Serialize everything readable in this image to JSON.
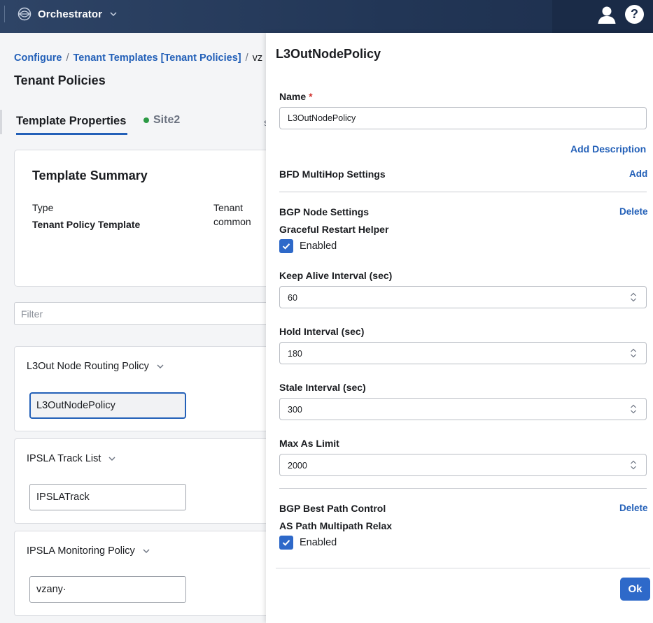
{
  "app": {
    "title": "Orchestrator",
    "logo_icon": "cisco-orchestrator-icon",
    "user_icon": "user-icon",
    "help_label": "?"
  },
  "breadcrumb": {
    "items": [
      "Configure",
      "Tenant Templates [Tenant Policies]",
      "vz"
    ],
    "separator": "/"
  },
  "page": {
    "title": "Tenant Policies",
    "tabs": [
      {
        "label": "Template Properties",
        "active": true
      },
      {
        "label": "Site2",
        "status_color": "#2c9a45"
      }
    ],
    "tab_overflow": "s"
  },
  "summary": {
    "title": "Template Summary",
    "type_label": "Type",
    "type_value": "Tenant Policy Template",
    "tenant_label": "Tenant",
    "tenant_value": "common"
  },
  "filter": {
    "placeholder": "Filter"
  },
  "groups": [
    {
      "title": "L3Out Node Routing Policy",
      "item": "L3OutNodePolicy",
      "selected": true
    },
    {
      "title": "IPSLA Track List",
      "item": "IPSLATrack",
      "selected": false
    },
    {
      "title": "IPSLA Monitoring Policy",
      "item": "vzany·",
      "selected": false
    }
  ],
  "panel": {
    "title": "L3OutNodePolicy",
    "name_label": "Name",
    "required_mark": "*",
    "name_value": "L3OutNodePolicy",
    "add_description": "Add Description",
    "bfd": {
      "title": "BFD MultiHop Settings",
      "action": "Add"
    },
    "bgp_node": {
      "title": "BGP Node Settings",
      "action": "Delete",
      "graceful_label": "Graceful Restart Helper",
      "graceful_checkbox": "Enabled",
      "keep_alive_label": "Keep Alive Interval (sec)",
      "keep_alive_value": "60",
      "hold_label": "Hold Interval (sec)",
      "hold_value": "180",
      "stale_label": "Stale Interval (sec)",
      "stale_value": "300",
      "max_as_label": "Max As Limit",
      "max_as_value": "2000"
    },
    "bgp_best_path": {
      "title": "BGP Best Path Control",
      "action": "Delete",
      "multipath_label": "AS Path Multipath Relax",
      "multipath_checkbox": "Enabled"
    },
    "ok_label": "Ok"
  },
  "colors": {
    "accent": "#2e69c9",
    "link": "#2360b8",
    "navbar": "#223656",
    "required": "#d0312d"
  }
}
